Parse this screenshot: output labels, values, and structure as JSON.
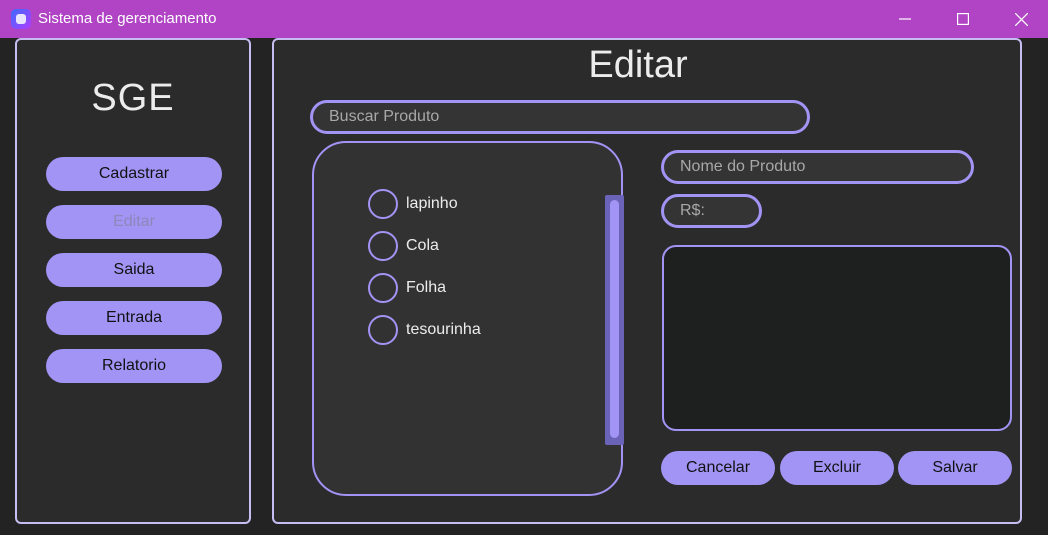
{
  "window": {
    "title": "Sistema de gerenciamento",
    "controls": [
      "minimize-icon",
      "maximize-icon",
      "close-icon"
    ],
    "accent_color": "#b044c4"
  },
  "sidebar": {
    "logo": "SGE",
    "items": [
      {
        "label": "Cadastrar",
        "state": "normal"
      },
      {
        "label": "Editar",
        "state": "disabled"
      },
      {
        "label": "Saida",
        "state": "normal"
      },
      {
        "label": "Entrada",
        "state": "normal"
      },
      {
        "label": "Relatorio",
        "state": "normal"
      }
    ]
  },
  "main": {
    "title": "Editar",
    "search": {
      "placeholder": "Buscar Produto",
      "value": ""
    },
    "products": [
      {
        "label": "lapinho",
        "selected": false
      },
      {
        "label": "Cola",
        "selected": false
      },
      {
        "label": "Folha",
        "selected": false
      },
      {
        "label": "tesourinha",
        "selected": false
      }
    ],
    "form": {
      "name_placeholder": "Nome do Produto",
      "price_placeholder": "R$:",
      "description": ""
    },
    "actions": {
      "cancel": "Cancelar",
      "delete": "Excluir",
      "save": "Salvar"
    }
  },
  "colors": {
    "button": "#a294f5",
    "border": "#c8bdf2",
    "background": "#2b2b2b"
  }
}
